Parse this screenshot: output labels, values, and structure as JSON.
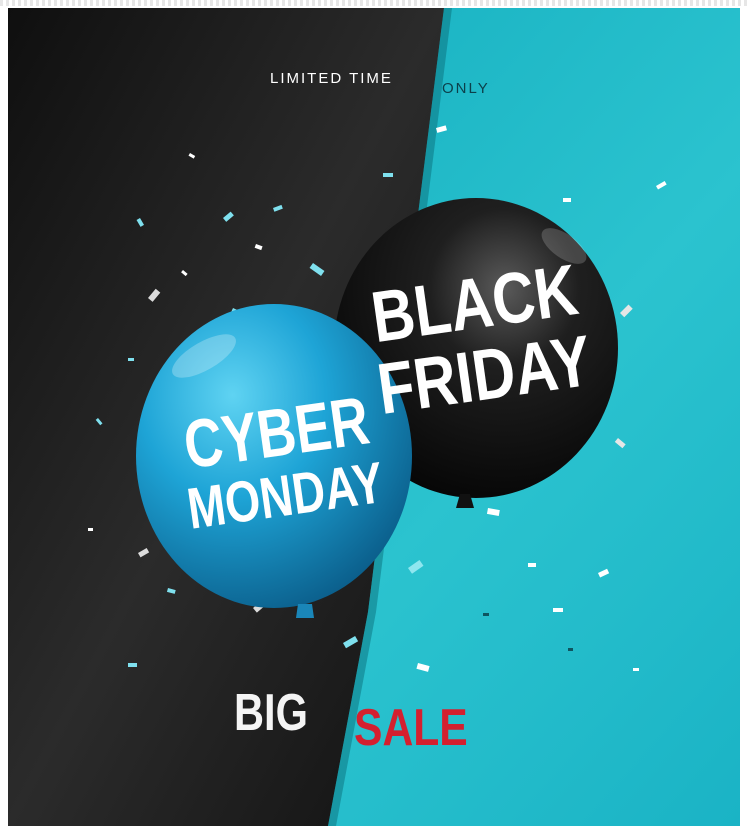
{
  "poster": {
    "top_text_1": "LIMITED TIME",
    "top_text_2": "ONLY",
    "blue_balloon": {
      "line1": "CYBER",
      "line2": "MONDAY"
    },
    "black_balloon": {
      "line1": "BLACK",
      "line2": "FRIDAY"
    },
    "bottom_left": "BIG",
    "bottom_right": "SALE"
  },
  "colors": {
    "dark_panel": "#1a1a1a",
    "teal_panel": "#14aebf",
    "blue_balloon": "#1c9fd0",
    "black_balloon": "#141414",
    "sale_red": "#d4202f"
  }
}
